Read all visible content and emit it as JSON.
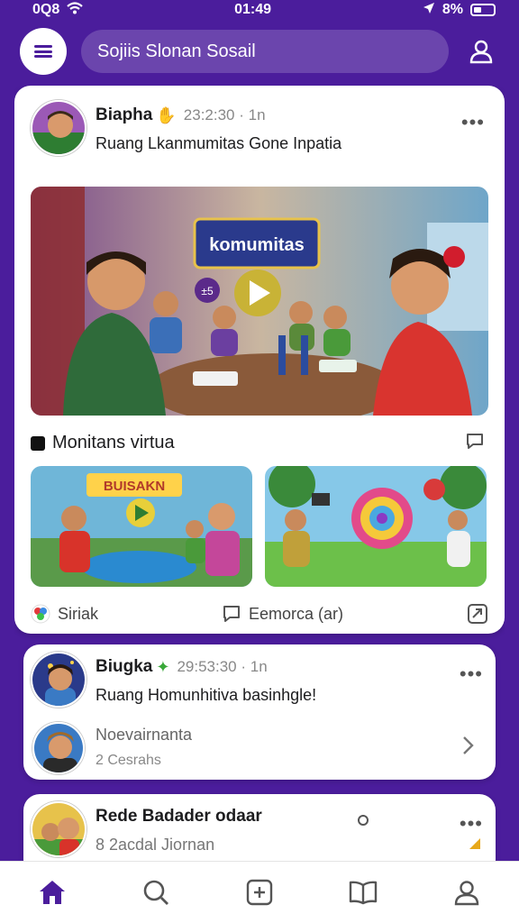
{
  "status": {
    "time_left": "0Q8",
    "time_center": "01:49",
    "battery": "8%"
  },
  "header": {
    "search_text": "Sojiis Slonan Sosail"
  },
  "post1": {
    "author": "Biapha",
    "meta": "23:2:30 · 1n",
    "text": "Ruang Lkanmumitas Gone Inpatia",
    "hero_banner": "komumitas",
    "hero_badge": "±5",
    "section_title": "Monitans virtua",
    "thumb1_banner": "BUISAKN",
    "actions": {
      "like": "Siriak",
      "comment": "Eemorca (ar)"
    }
  },
  "post2": {
    "author": "Biugka",
    "meta": "29:53:30 · 1n",
    "text": "Ruang Homunhitiva basinhgle!",
    "sub_name": "Noevairnanta",
    "sub_count": "2 Cesrahs"
  },
  "post3": {
    "author": "Rede Badader odaar",
    "meta": "8 2acdal Jiornan"
  },
  "nav": [
    "home-icon",
    "search-icon",
    "add-icon",
    "book-icon",
    "profile-icon"
  ],
  "colors": {
    "brand": "#4b1d9c",
    "accent": "#6a2fc4"
  }
}
